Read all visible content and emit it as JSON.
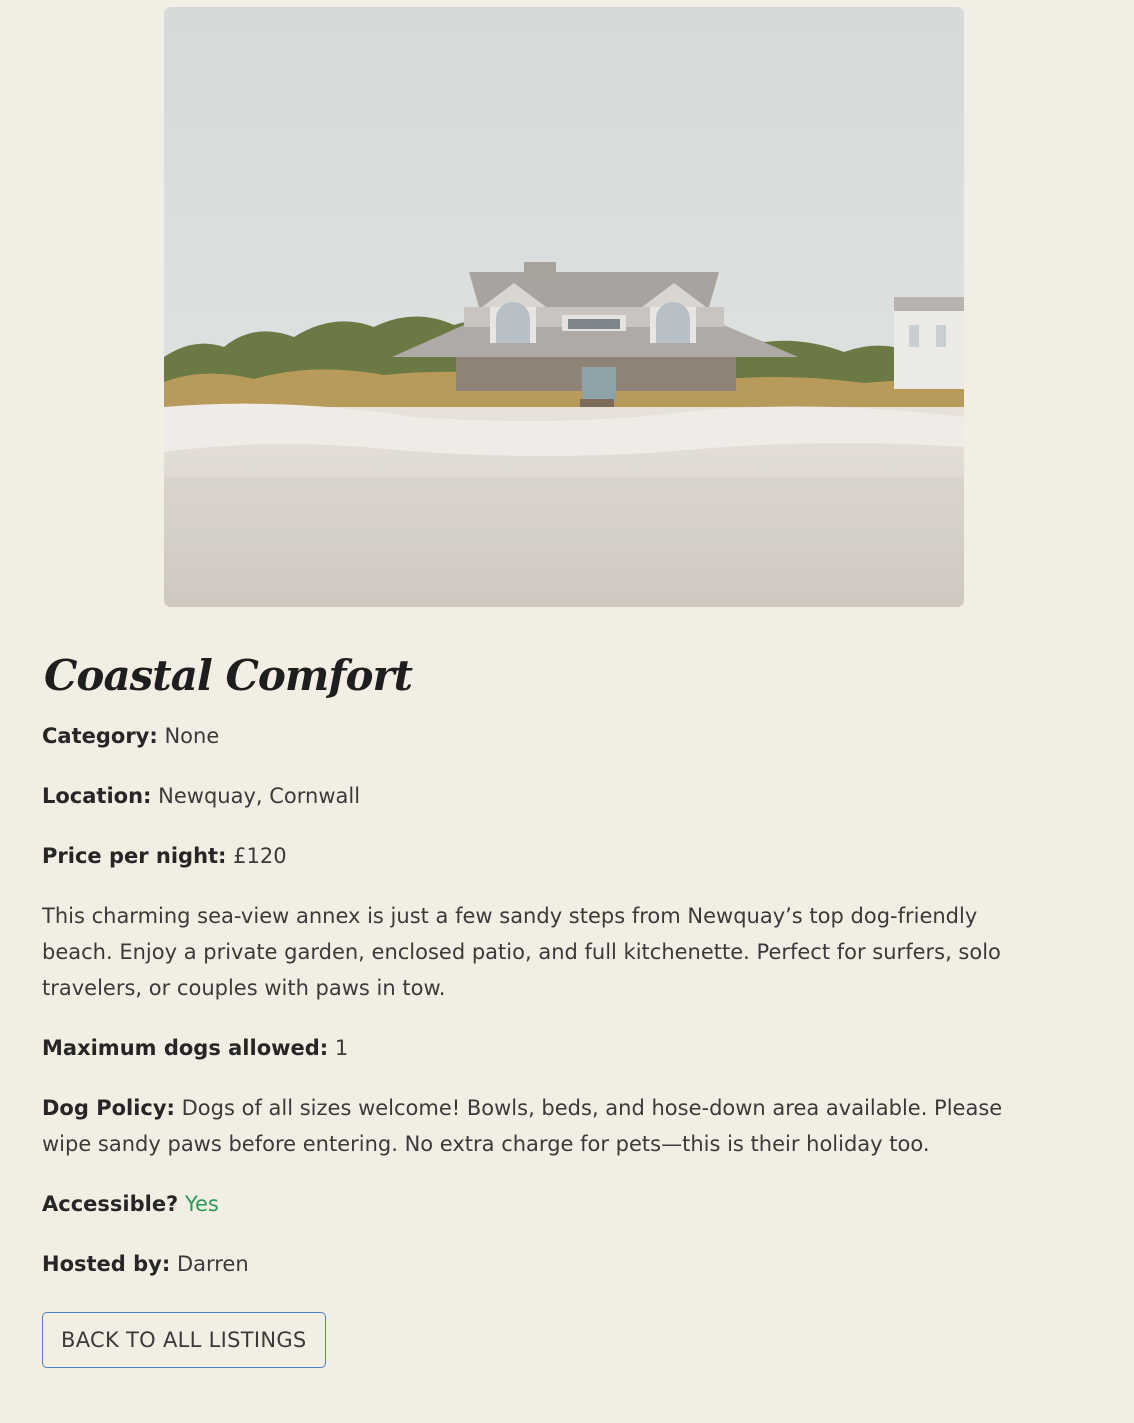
{
  "listing": {
    "title": "Coastal Comfort",
    "category_label": "Category:",
    "category_value": "None",
    "location_label": "Location:",
    "location_value": "Newquay, Cornwall",
    "price_label": "Price per night:",
    "price_value": "£120",
    "description": "This charming sea-view annex is just a few sandy steps from Newquay’s top dog-friendly beach. Enjoy a private garden, enclosed patio, and full kitchenette. Perfect for surfers, solo travelers, or couples with paws in tow.",
    "max_dogs_label": "Maximum dogs allowed:",
    "max_dogs_value": "1",
    "dog_policy_label": "Dog Policy:",
    "dog_policy_value": "Dogs of all sizes welcome! Bowls, beds, and hose-down area available. Please wipe sandy paws before entering. No extra charge for pets—this is their holiday too.",
    "accessible_label": "Accessible?",
    "accessible_value": "Yes",
    "host_label": "Hosted by:",
    "host_value": "Darren"
  },
  "actions": {
    "back_label": "BACK TO ALL LISTINGS"
  },
  "colors": {
    "background": "#f2eee3",
    "accessible_yes": "#2c9b58",
    "button_border": "#4d7fc6"
  }
}
